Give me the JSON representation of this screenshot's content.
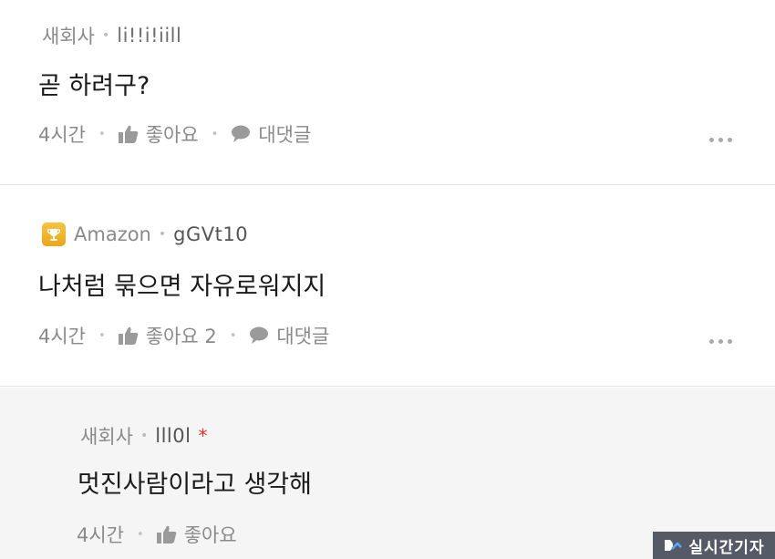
{
  "comments": [
    {
      "company": "새회사",
      "nickname": "li!!i!iill",
      "text": "곧 하려구?",
      "time": "4시간",
      "like_label": "좋아요",
      "reply_label": "대댓글"
    },
    {
      "company": "Amazon",
      "nickname": "gGVt10",
      "text": "나처럼 묶으면 자유로워지지",
      "time": "4시간",
      "like_label": "좋아요 2",
      "reply_label": "대댓글"
    },
    {
      "company": "새회사",
      "nickname": "lll0l",
      "author_marker": "*",
      "text": "멋진사람이라고 생각해",
      "time": "4시간",
      "like_label": "좋아요"
    }
  ],
  "separator": "•",
  "watermark": "실시간기자",
  "colors": {
    "meta_gray": "#8a8a8a",
    "author_star": "#e0352b",
    "reply_bg": "#f5f5f5",
    "divider": "#e2e2e2",
    "trophy": "#f6c343",
    "watermark_bg": "#555a66"
  },
  "icons": {
    "like": "thumbs-up-icon",
    "reply": "speech-bubble-icon",
    "more": "more-dots-icon",
    "badge": "trophy-icon"
  }
}
